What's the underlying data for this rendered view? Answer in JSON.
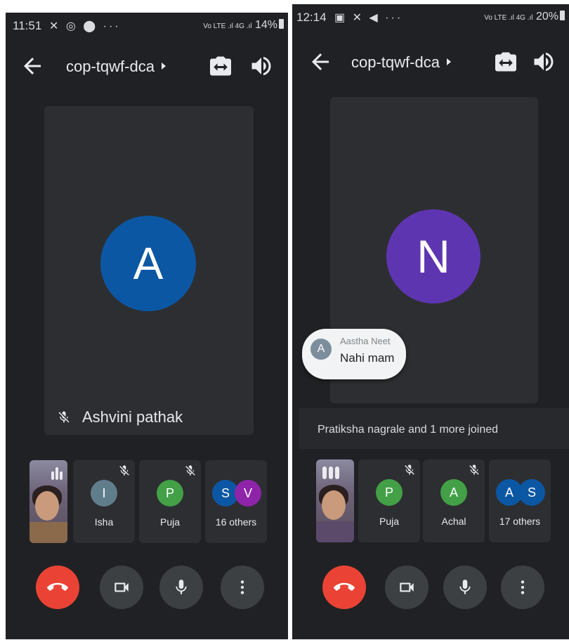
{
  "left_screen": {
    "status": {
      "time": "11:51",
      "icons": "✕ ◎ ⬤ ···",
      "signal": "Vo LTE .ıl 4G .ıl",
      "battery": "14%"
    },
    "meeting_title": "cop-tqwf-dca",
    "main_participant": {
      "initial": "A",
      "name": "Ashvini pathak",
      "color": "#0b57a4",
      "muted": true
    },
    "tiles": [
      {
        "initial": "I",
        "name": "Isha",
        "color": "#607d8b",
        "muted": true
      },
      {
        "initial": "P",
        "name": "Puja",
        "color": "#43a047",
        "muted": true
      },
      {
        "initials": [
          "S",
          "V"
        ],
        "colors": [
          "#0b57a4",
          "#8e24aa"
        ],
        "name": "16 others"
      }
    ]
  },
  "right_screen": {
    "status": {
      "time": "12:14",
      "icons": "▣ ✕ ◀ ···",
      "signal": "Vo LTE .ıl 4G .ıl",
      "battery": "20%"
    },
    "meeting_title": "cop-tqwf-dca",
    "main_participant": {
      "initial": "N",
      "color": "#5e35b1"
    },
    "chat": {
      "sender_initial": "A",
      "sender": "Aastha Neet",
      "message": "Nahi mam"
    },
    "notice": "Pratiksha nagrale and 1 more joined",
    "tiles": [
      {
        "initial": "P",
        "name": "Puja",
        "color": "#43a047",
        "muted": true
      },
      {
        "initial": "A",
        "name": "Achal",
        "color": "#43a047",
        "muted": true
      },
      {
        "initials": [
          "A",
          "S"
        ],
        "colors": [
          "#0b57a4",
          "#0b57a4"
        ],
        "name": "17 others"
      }
    ]
  },
  "controls": [
    "end-call",
    "camera",
    "microphone",
    "more-options"
  ],
  "colors": {
    "background": "#202124",
    "tile": "#2d2e31",
    "end_call": "#ea4335",
    "control": "#3c4043"
  }
}
